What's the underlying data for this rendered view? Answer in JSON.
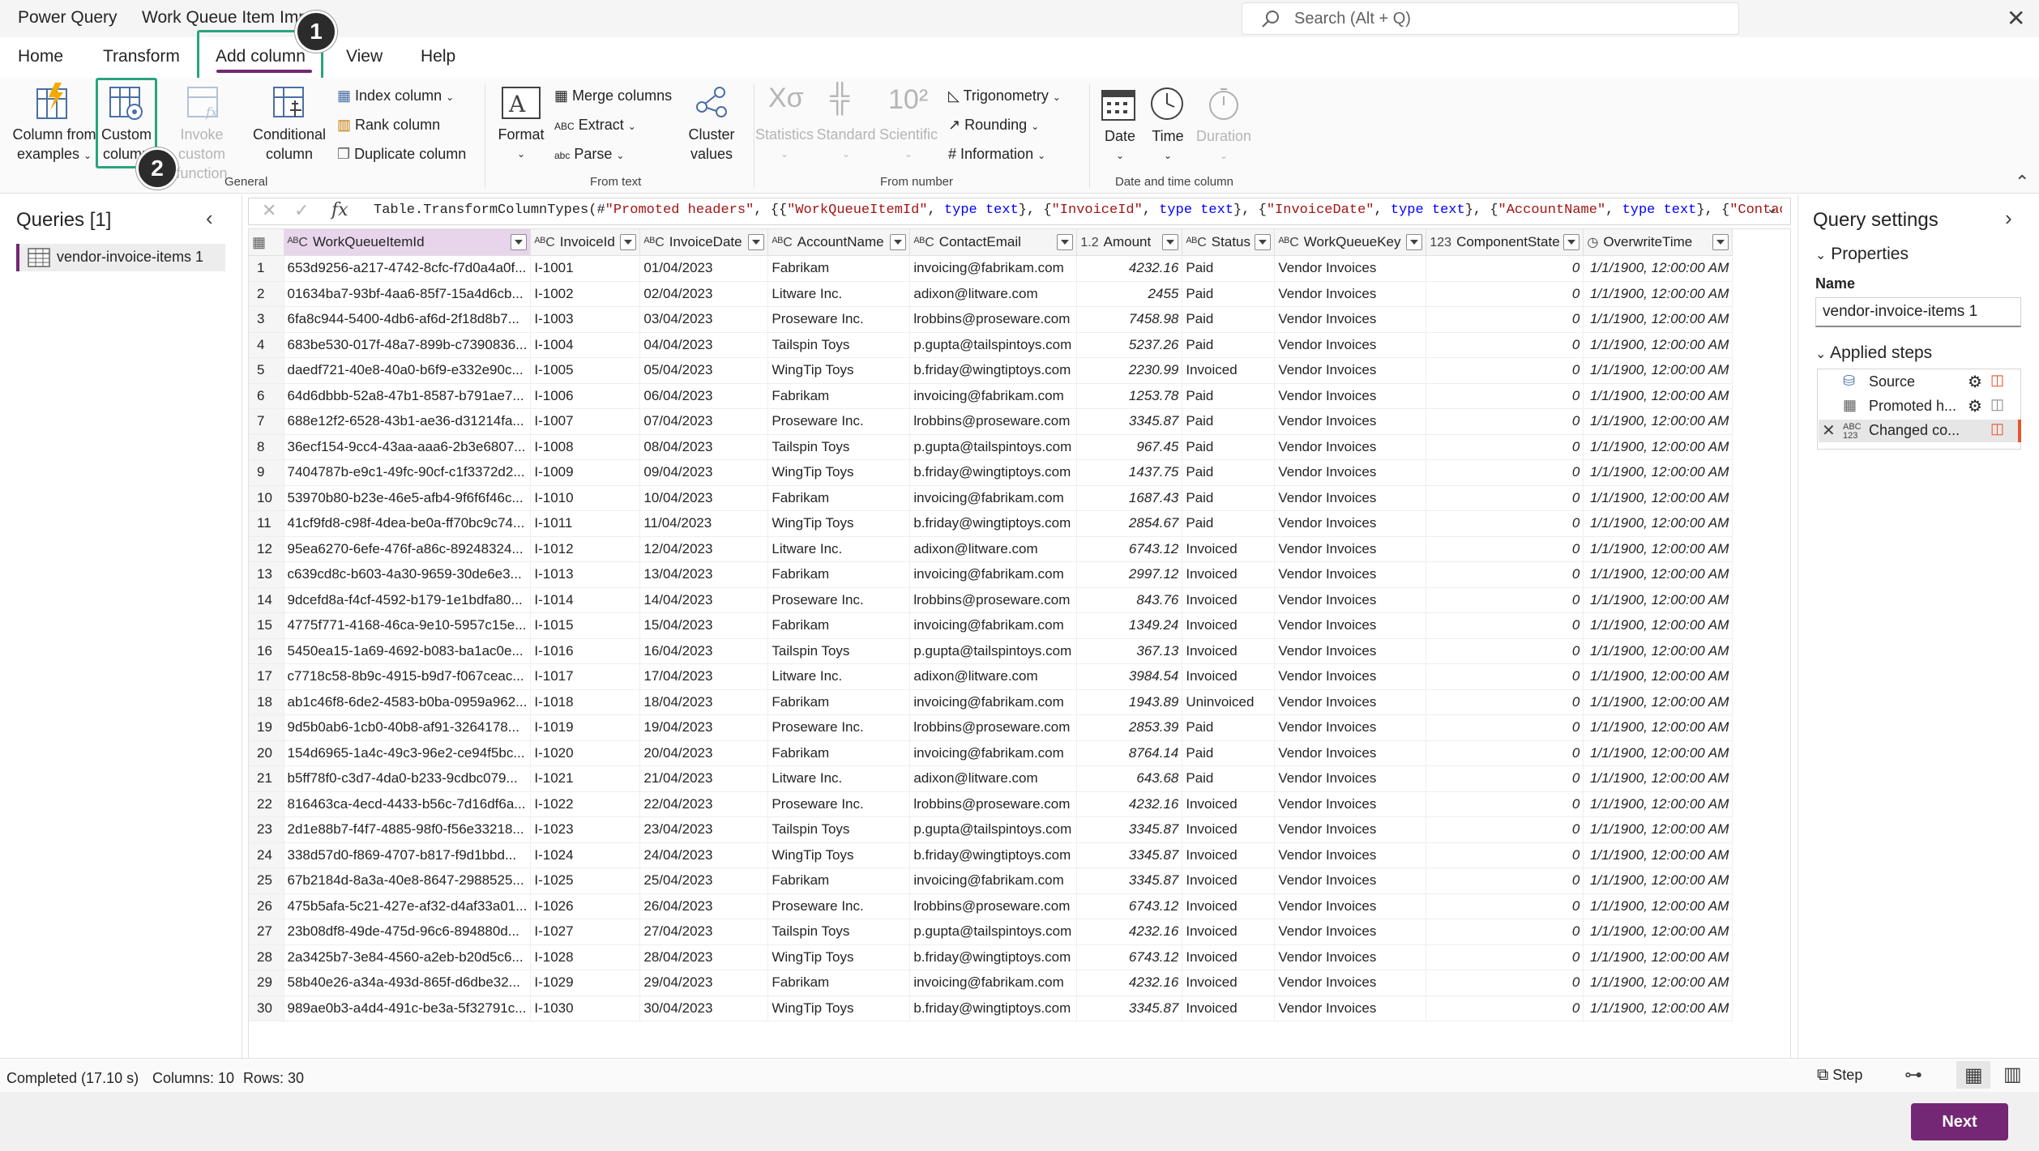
{
  "titlebar": {
    "app_name": "Power Query",
    "doc_title": "Work Queue Item Imp",
    "search_placeholder": "Search (Alt + Q)"
  },
  "menu_tabs": [
    "Home",
    "Transform",
    "Add column",
    "View",
    "Help"
  ],
  "active_tab": "Add column",
  "ribbon": {
    "general": {
      "group_label": "General",
      "column_from_examples": [
        "Column from",
        "examples"
      ],
      "custom_column": [
        "Custom",
        "column"
      ],
      "invoke_custom_function": [
        "Invoke custom",
        "function"
      ],
      "conditional_column": [
        "Conditional",
        "column"
      ],
      "index_column": "Index column",
      "rank_column": "Rank column",
      "duplicate_column": "Duplicate column"
    },
    "from_text": {
      "group_label": "From text",
      "format": "Format",
      "merge_columns": "Merge columns",
      "extract": "Extract",
      "parse": "Parse",
      "cluster_values": [
        "Cluster",
        "values"
      ]
    },
    "from_number": {
      "group_label": "From number",
      "statistics": "Statistics",
      "standard": "Standard",
      "scientific": "Scientific",
      "trigonometry": "Trigonometry",
      "rounding": "Rounding",
      "information": "Information"
    },
    "date_time": {
      "group_label": "Date and time column",
      "date": "Date",
      "time": "Time",
      "duration": "Duration"
    }
  },
  "callouts": [
    "1",
    "2"
  ],
  "queries_panel": {
    "title": "Queries [1]",
    "items": [
      "vendor-invoice-items 1"
    ]
  },
  "formula": {
    "p1": "Table.TransformColumnTypes(#",
    "s1": "\"Promoted headers\"",
    "p2": ", {{",
    "s2": "\"WorkQueueItemId\"",
    "p3": ", ",
    "k1": "type text",
    "p4": "}, {",
    "s3": "\"InvoiceId\"",
    "p5": ", ",
    "k2": "type text",
    "p6": "}, {",
    "s4": "\"InvoiceDate\"",
    "p7": ", ",
    "k3": "type text",
    "p8": "}, {",
    "s5": "\"AccountName\"",
    "p9": ", ",
    "k4": "type text",
    "p10": "}, {",
    "s6": "\"ContactE"
  },
  "grid": {
    "columns": [
      {
        "type": "ABC",
        "name": "WorkQueueItemId"
      },
      {
        "type": "ABC",
        "name": "InvoiceId"
      },
      {
        "type": "ABC",
        "name": "InvoiceDate"
      },
      {
        "type": "ABC",
        "name": "AccountName"
      },
      {
        "type": "ABC",
        "name": "ContactEmail"
      },
      {
        "type": "1.2",
        "name": "Amount"
      },
      {
        "type": "ABC",
        "name": "Status"
      },
      {
        "type": "ABC",
        "name": "WorkQueueKey"
      },
      {
        "type": "123",
        "name": "ComponentState"
      },
      {
        "type": "dt",
        "name": "OverwriteTime"
      }
    ],
    "rows": [
      [
        "1",
        "653d9256-a217-4742-8cfc-f7d0a4a0f...",
        "I-1001",
        "01/04/2023",
        "Fabrikam",
        "invoicing@fabrikam.com",
        "4232.16",
        "Paid",
        "Vendor Invoices",
        "0",
        "1/1/1900, 12:00:00 AM"
      ],
      [
        "2",
        "01634ba7-93bf-4aa6-85f7-15a4d6cb...",
        "I-1002",
        "02/04/2023",
        "Litware Inc.",
        "adixon@litware.com",
        "2455",
        "Paid",
        "Vendor Invoices",
        "0",
        "1/1/1900, 12:00:00 AM"
      ],
      [
        "3",
        "6fa8c944-5400-4db6-af6d-2f18d8b7...",
        "I-1003",
        "03/04/2023",
        "Proseware Inc.",
        "lrobbins@proseware.com",
        "7458.98",
        "Paid",
        "Vendor Invoices",
        "0",
        "1/1/1900, 12:00:00 AM"
      ],
      [
        "4",
        "683be530-017f-48a7-899b-c7390836...",
        "I-1004",
        "04/04/2023",
        "Tailspin Toys",
        "p.gupta@tailspintoys.com",
        "5237.26",
        "Paid",
        "Vendor Invoices",
        "0",
        "1/1/1900, 12:00:00 AM"
      ],
      [
        "5",
        "daedf721-40e8-40a0-b6f9-e332e90c...",
        "I-1005",
        "05/04/2023",
        "WingTip Toys",
        "b.friday@wingtiptoys.com",
        "2230.99",
        "Invoiced",
        "Vendor Invoices",
        "0",
        "1/1/1900, 12:00:00 AM"
      ],
      [
        "6",
        "64d6dbbb-52a8-47b1-8587-b791ae7...",
        "I-1006",
        "06/04/2023",
        "Fabrikam",
        "invoicing@fabrikam.com",
        "1253.78",
        "Paid",
        "Vendor Invoices",
        "0",
        "1/1/1900, 12:00:00 AM"
      ],
      [
        "7",
        "688e12f2-6528-43b1-ae36-d31214fa...",
        "I-1007",
        "07/04/2023",
        "Proseware Inc.",
        "lrobbins@proseware.com",
        "3345.87",
        "Paid",
        "Vendor Invoices",
        "0",
        "1/1/1900, 12:00:00 AM"
      ],
      [
        "8",
        "36ecf154-9cc4-43aa-aaa6-2b3e6807...",
        "I-1008",
        "08/04/2023",
        "Tailspin Toys",
        "p.gupta@tailspintoys.com",
        "967.45",
        "Paid",
        "Vendor Invoices",
        "0",
        "1/1/1900, 12:00:00 AM"
      ],
      [
        "9",
        "7404787b-e9c1-49fc-90cf-c1f3372d2...",
        "I-1009",
        "09/04/2023",
        "WingTip Toys",
        "b.friday@wingtiptoys.com",
        "1437.75",
        "Paid",
        "Vendor Invoices",
        "0",
        "1/1/1900, 12:00:00 AM"
      ],
      [
        "10",
        "53970b80-b23e-46e5-afb4-9f6f6f46c...",
        "I-1010",
        "10/04/2023",
        "Fabrikam",
        "invoicing@fabrikam.com",
        "1687.43",
        "Paid",
        "Vendor Invoices",
        "0",
        "1/1/1900, 12:00:00 AM"
      ],
      [
        "11",
        "41cf9fd8-c98f-4dea-be0a-ff70bc9c74...",
        "I-1011",
        "11/04/2023",
        "WingTip Toys",
        "b.friday@wingtiptoys.com",
        "2854.67",
        "Paid",
        "Vendor Invoices",
        "0",
        "1/1/1900, 12:00:00 AM"
      ],
      [
        "12",
        "95ea6270-6efe-476f-a86c-89248324...",
        "I-1012",
        "12/04/2023",
        "Litware Inc.",
        "adixon@litware.com",
        "6743.12",
        "Invoiced",
        "Vendor Invoices",
        "0",
        "1/1/1900, 12:00:00 AM"
      ],
      [
        "13",
        "c639cd8c-b603-4a30-9659-30de6e3...",
        "I-1013",
        "13/04/2023",
        "Fabrikam",
        "invoicing@fabrikam.com",
        "2997.12",
        "Invoiced",
        "Vendor Invoices",
        "0",
        "1/1/1900, 12:00:00 AM"
      ],
      [
        "14",
        "9dcefd8a-f4cf-4592-b179-1e1bdfa80...",
        "I-1014",
        "14/04/2023",
        "Proseware Inc.",
        "lrobbins@proseware.com",
        "843.76",
        "Invoiced",
        "Vendor Invoices",
        "0",
        "1/1/1900, 12:00:00 AM"
      ],
      [
        "15",
        "4775f771-4168-46ca-9e10-5957c15e...",
        "I-1015",
        "15/04/2023",
        "Fabrikam",
        "invoicing@fabrikam.com",
        "1349.24",
        "Invoiced",
        "Vendor Invoices",
        "0",
        "1/1/1900, 12:00:00 AM"
      ],
      [
        "16",
        "5450ea15-1a69-4692-b083-ba1ac0e...",
        "I-1016",
        "16/04/2023",
        "Tailspin Toys",
        "p.gupta@tailspintoys.com",
        "367.13",
        "Invoiced",
        "Vendor Invoices",
        "0",
        "1/1/1900, 12:00:00 AM"
      ],
      [
        "17",
        "c7718c58-8b9c-4915-b9d7-f067ceac...",
        "I-1017",
        "17/04/2023",
        "Litware Inc.",
        "adixon@litware.com",
        "3984.54",
        "Invoiced",
        "Vendor Invoices",
        "0",
        "1/1/1900, 12:00:00 AM"
      ],
      [
        "18",
        "ab1c46f8-6de2-4583-b0ba-0959a962...",
        "I-1018",
        "18/04/2023",
        "Fabrikam",
        "invoicing@fabrikam.com",
        "1943.89",
        "Uninvoiced",
        "Vendor Invoices",
        "0",
        "1/1/1900, 12:00:00 AM"
      ],
      [
        "19",
        "9d5b0ab6-1cb0-40b8-af91-3264178...",
        "I-1019",
        "19/04/2023",
        "Proseware Inc.",
        "lrobbins@proseware.com",
        "2853.39",
        "Paid",
        "Vendor Invoices",
        "0",
        "1/1/1900, 12:00:00 AM"
      ],
      [
        "20",
        "154d6965-1a4c-49c3-96e2-ce94f5bc...",
        "I-1020",
        "20/04/2023",
        "Fabrikam",
        "invoicing@fabrikam.com",
        "8764.14",
        "Paid",
        "Vendor Invoices",
        "0",
        "1/1/1900, 12:00:00 AM"
      ],
      [
        "21",
        "b5ff78f0-c3d7-4da0-b233-9cdbc079...",
        "I-1021",
        "21/04/2023",
        "Litware Inc.",
        "adixon@litware.com",
        "643.68",
        "Paid",
        "Vendor Invoices",
        "0",
        "1/1/1900, 12:00:00 AM"
      ],
      [
        "22",
        "816463ca-4ecd-4433-b56c-7d16df6a...",
        "I-1022",
        "22/04/2023",
        "Proseware Inc.",
        "lrobbins@proseware.com",
        "4232.16",
        "Invoiced",
        "Vendor Invoices",
        "0",
        "1/1/1900, 12:00:00 AM"
      ],
      [
        "23",
        "2d1e88b7-f4f7-4885-98f0-f56e33218...",
        "I-1023",
        "23/04/2023",
        "Tailspin Toys",
        "p.gupta@tailspintoys.com",
        "3345.87",
        "Invoiced",
        "Vendor Invoices",
        "0",
        "1/1/1900, 12:00:00 AM"
      ],
      [
        "24",
        "338d57d0-f869-4707-b817-f9d1bbd...",
        "I-1024",
        "24/04/2023",
        "WingTip Toys",
        "b.friday@wingtiptoys.com",
        "3345.87",
        "Invoiced",
        "Vendor Invoices",
        "0",
        "1/1/1900, 12:00:00 AM"
      ],
      [
        "25",
        "67b2184d-8a3a-40e8-8647-2988525...",
        "I-1025",
        "25/04/2023",
        "Fabrikam",
        "invoicing@fabrikam.com",
        "3345.87",
        "Invoiced",
        "Vendor Invoices",
        "0",
        "1/1/1900, 12:00:00 AM"
      ],
      [
        "26",
        "475b5afa-5c21-427e-af32-d4af33a01...",
        "I-1026",
        "26/04/2023",
        "Proseware Inc.",
        "lrobbins@proseware.com",
        "6743.12",
        "Invoiced",
        "Vendor Invoices",
        "0",
        "1/1/1900, 12:00:00 AM"
      ],
      [
        "27",
        "23b08df8-49de-475d-96c6-894880d...",
        "I-1027",
        "27/04/2023",
        "Tailspin Toys",
        "p.gupta@tailspintoys.com",
        "4232.16",
        "Invoiced",
        "Vendor Invoices",
        "0",
        "1/1/1900, 12:00:00 AM"
      ],
      [
        "28",
        "2a3425b7-3e84-4560-a2eb-b20d5c6...",
        "I-1028",
        "28/04/2023",
        "WingTip Toys",
        "b.friday@wingtiptoys.com",
        "6743.12",
        "Invoiced",
        "Vendor Invoices",
        "0",
        "1/1/1900, 12:00:00 AM"
      ],
      [
        "29",
        "58b40e26-a34a-493d-865f-d6dbe32...",
        "I-1029",
        "29/04/2023",
        "Fabrikam",
        "invoicing@fabrikam.com",
        "4232.16",
        "Invoiced",
        "Vendor Invoices",
        "0",
        "1/1/1900, 12:00:00 AM"
      ],
      [
        "30",
        "989ae0b3-a4d4-491c-be3a-5f32791c...",
        "I-1030",
        "30/04/2023",
        "WingTip Toys",
        "b.friday@wingtiptoys.com",
        "3345.87",
        "Invoiced",
        "Vendor Invoices",
        "0",
        "1/1/1900, 12:00:00 AM"
      ]
    ]
  },
  "query_settings": {
    "title": "Query settings",
    "properties_label": "Properties",
    "name_label": "Name",
    "name_value": "vendor-invoice-items 1",
    "applied_steps_label": "Applied steps",
    "steps": [
      "Source",
      "Promoted h...",
      "Changed co..."
    ]
  },
  "status": {
    "completed": "Completed (17.10 s)",
    "columns": "Columns: 10",
    "rows": "Rows: 30",
    "step_label": "Step"
  },
  "footer": {
    "next_label": "Next"
  },
  "colors": {
    "accent": "#742774",
    "highlight": "#2aa37f",
    "step_marker": "#e8542c"
  }
}
